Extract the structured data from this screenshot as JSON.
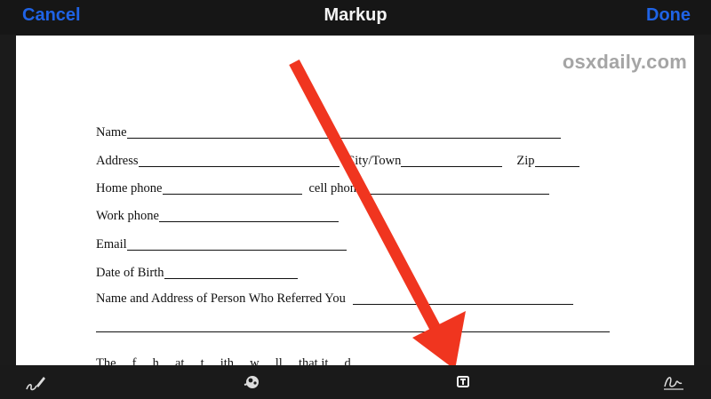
{
  "nav": {
    "cancel_label": "Cancel",
    "title": "Markup",
    "done_label": "Done",
    "accent_color": "#1f63e6"
  },
  "watermark": "osxdaily.com",
  "form": {
    "name_label": "Name",
    "address_label": "Address",
    "city_label": "City/Town",
    "zip_label": "Zip",
    "home_phone_label": "Home phone",
    "cell_phone_label": "cell phone",
    "work_phone_label": "Work phone",
    "email_label": "Email",
    "dob_label": "Date of Birth",
    "referral_label": "Name and Address of Person Who Referred You",
    "cut_text": "The ... f ... h ... at ... t ... ith ... w ... ll ... that it ... d"
  },
  "annotation": {
    "arrow_color": "#f0351f",
    "points_to": "text-tool"
  },
  "toolbar": {
    "tools": [
      {
        "id": "sketch",
        "icon": "pen-sketch-icon"
      },
      {
        "id": "magnify",
        "icon": "magnifier-loupe-icon"
      },
      {
        "id": "text",
        "icon": "text-box-icon"
      },
      {
        "id": "signature",
        "icon": "signature-icon"
      }
    ]
  }
}
